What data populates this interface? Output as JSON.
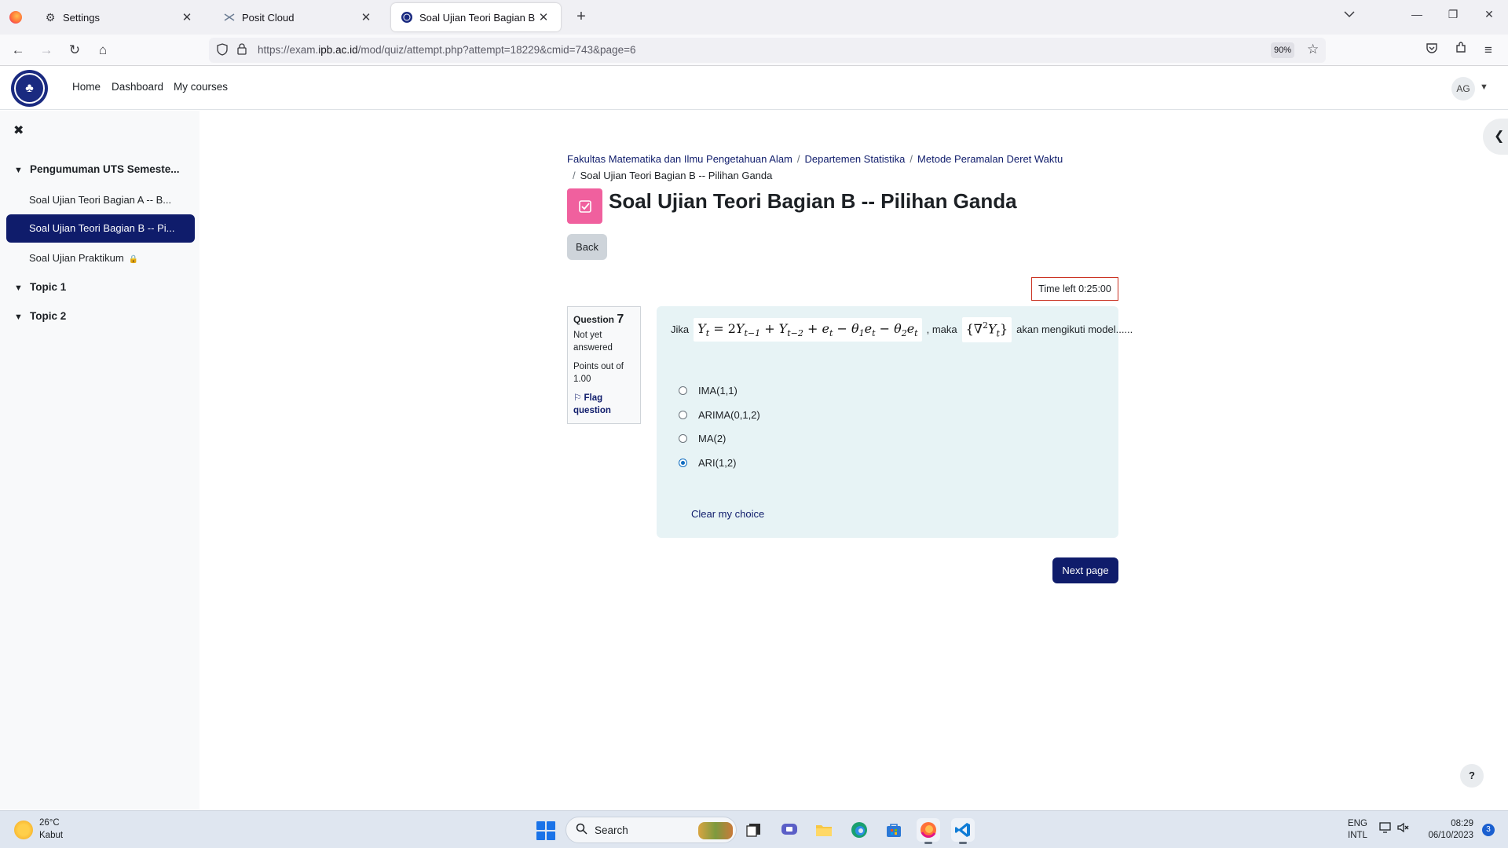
{
  "browser": {
    "tabs": [
      {
        "title": "Settings",
        "icon": "gear-icon"
      },
      {
        "title": "Posit Cloud",
        "icon": "posit-icon"
      },
      {
        "title": "Soal Ujian Teori Bagian B -- Pilih",
        "icon": "moodle-favicon-icon"
      }
    ],
    "url_prefix": "https://exam.",
    "url_domain": "ipb.ac.id",
    "url_rest": "/mod/quiz/attempt.php?attempt=18229&cmid=743&page=6",
    "zoom": "90%"
  },
  "header": {
    "nav": [
      "Home",
      "Dashboard",
      "My courses"
    ],
    "avatar_initials": "AG"
  },
  "drawer": {
    "section_main": "Pengumuman UTS Semeste...",
    "items": [
      {
        "label": "Soal Ujian Teori Bagian A -- B..."
      },
      {
        "label": "Soal Ujian Teori Bagian B -- Pi..."
      },
      {
        "label": "Soal Ujian Praktikum"
      }
    ],
    "topics": [
      "Topic 1",
      "Topic 2"
    ]
  },
  "main": {
    "breadcrumb": [
      "Fakultas Matematika dan Ilmu Pengetahuan Alam",
      "Departemen Statistika",
      "Metode Peramalan Deret Waktu",
      "Soal Ujian Teori Bagian B -- Pilihan Ganda"
    ],
    "title": "Soal Ujian Teori Bagian B -- Pilihan Ganda",
    "back_label": "Back",
    "timer_label": "Time left",
    "timer_value": "0:25:00",
    "question": {
      "label": "Question",
      "number": "7",
      "status": "Not yet answered",
      "points": "Points out of 1.00",
      "flag": "Flag question",
      "text_before": "Jika",
      "text_middle": ", maka",
      "text_after": "akan mengikuti model......",
      "options": [
        "IMA(1,1)",
        "ARIMA(0,1,2)",
        "MA(2)",
        "ARI(1,2)"
      ],
      "selected_index": 3,
      "clear_label": "Clear my choice"
    },
    "next_label": "Next page",
    "help_label": "?"
  },
  "taskbar": {
    "temperature": "26°C",
    "weather": "Kabut",
    "search_placeholder": "Search",
    "lang_top": "ENG",
    "lang_bottom": "INTL",
    "time": "08:29",
    "date": "06/10/2023",
    "notifications": "3"
  }
}
